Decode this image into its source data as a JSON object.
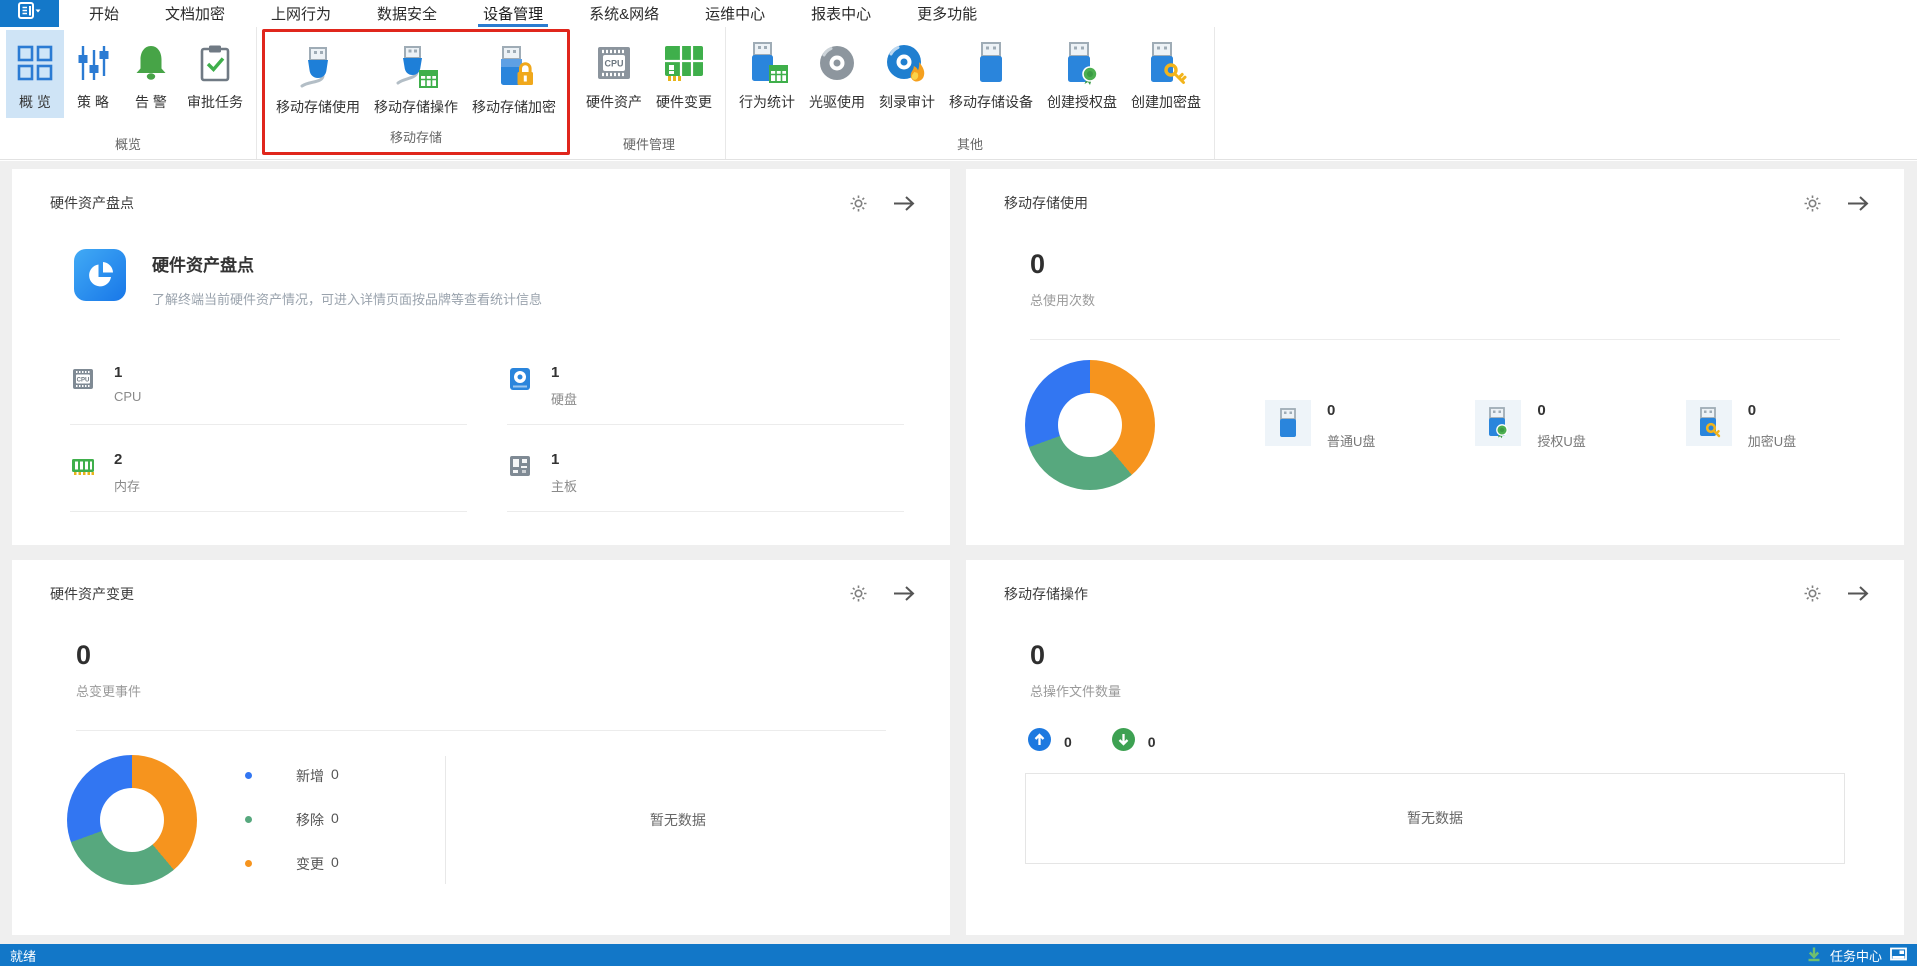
{
  "colors": {
    "accent_blue": "#1478c9",
    "menu_underline": "#2b7cd0",
    "highlight_red": "#e0261c",
    "ribbon_selected_bg": "#cfe4f6",
    "status_bar_blue": "#1277c8",
    "donut_blue": "#3276f2",
    "donut_orange": "#f6941e",
    "donut_green": "#57a87e"
  },
  "menu": {
    "app_icon": "app-menu-icon",
    "items": [
      {
        "label": "开始"
      },
      {
        "label": "文档加密"
      },
      {
        "label": "上网行为"
      },
      {
        "label": "数据安全"
      },
      {
        "label": "设备管理",
        "active": true
      },
      {
        "label": "系统&网络"
      },
      {
        "label": "运维中心"
      },
      {
        "label": "报表中心"
      },
      {
        "label": "更多功能"
      }
    ]
  },
  "ribbon": {
    "groups": [
      {
        "label": "概览",
        "buttons": [
          {
            "label": "概 览",
            "icon": "overview-grid-icon",
            "selected": true
          },
          {
            "label": "策 略",
            "icon": "policy-sliders-icon"
          },
          {
            "label": "告 警",
            "icon": "alert-bell-icon"
          },
          {
            "label": "审批任务",
            "icon": "approval-clipboard-icon"
          }
        ]
      },
      {
        "label": "移动存储",
        "highlighted": true,
        "buttons": [
          {
            "label": "移动存储使用",
            "icon": "usb-plug-icon"
          },
          {
            "label": "移动存储操作",
            "icon": "usb-plug-table-icon"
          },
          {
            "label": "移动存储加密",
            "icon": "usb-lock-icon"
          }
        ]
      },
      {
        "label": "硬件管理",
        "buttons": [
          {
            "label": "硬件资产",
            "icon": "cpu-chip-icon"
          },
          {
            "label": "硬件变更",
            "icon": "hardware-grid-icon"
          }
        ]
      },
      {
        "label": "其他",
        "buttons": [
          {
            "label": "行为统计",
            "icon": "usb-table-icon"
          },
          {
            "label": "光驱使用",
            "icon": "disc-icon"
          },
          {
            "label": "刻录审计",
            "icon": "disc-burn-icon"
          },
          {
            "label": "移动存储设备",
            "icon": "usb-stick-icon"
          },
          {
            "label": "创建授权盘",
            "icon": "usb-badge-icon"
          },
          {
            "label": "创建加密盘",
            "icon": "usb-key-icon"
          }
        ]
      }
    ]
  },
  "cards": {
    "hardware_inventory": {
      "header": "硬件资产盘点",
      "feature_title": "硬件资产盘点",
      "feature_desc": "了解终端当前硬件资产情况，可进入详情页面按品牌等查看统计信息",
      "stats": [
        {
          "icon": "cpu-icon",
          "value": "1",
          "label": "CPU"
        },
        {
          "icon": "harddisk-icon",
          "value": "1",
          "label": "硬盘"
        },
        {
          "icon": "memory-icon",
          "value": "2",
          "label": "内存"
        },
        {
          "icon": "mainboard-icon",
          "value": "1",
          "label": "主板"
        }
      ]
    },
    "storage_usage": {
      "header": "移动存储使用",
      "total_value": "0",
      "total_label": "总使用次数",
      "donut": {
        "type": "pie",
        "segments": [
          {
            "color": "#f6941e",
            "from": 0,
            "to": 140
          },
          {
            "color": "#57a87e",
            "from": 140,
            "to": 250
          },
          {
            "color": "#3276f2",
            "from": 250,
            "to": 360
          }
        ]
      },
      "stats": [
        {
          "icon": "usb-plain-icon",
          "value": "0",
          "label": "普通U盘"
        },
        {
          "icon": "usb-authorized-icon",
          "value": "0",
          "label": "授权U盘"
        },
        {
          "icon": "usb-encrypted-icon",
          "value": "0",
          "label": "加密U盘"
        }
      ]
    },
    "hardware_change": {
      "header": "硬件资产变更",
      "total_value": "0",
      "total_label": "总变更事件",
      "donut": {
        "type": "pie",
        "segments": [
          {
            "color": "#f6941e",
            "from": 0,
            "to": 140
          },
          {
            "color": "#57a87e",
            "from": 140,
            "to": 250
          },
          {
            "color": "#3276f2",
            "from": 250,
            "to": 360
          }
        ]
      },
      "legend": [
        {
          "color": "#3276f2",
          "label": "新增",
          "value": "0"
        },
        {
          "color": "#57a87e",
          "label": "移除",
          "value": "0"
        },
        {
          "color": "#f6941e",
          "label": "变更",
          "value": "0"
        }
      ],
      "empty_text": "暂无数据"
    },
    "storage_operation": {
      "header": "移动存储操作",
      "total_value": "0",
      "total_label": "总操作文件数量",
      "upload_value": "0",
      "download_value": "0",
      "empty_text": "暂无数据"
    }
  },
  "status_bar": {
    "ready": "就绪",
    "task_center": "任务中心"
  }
}
